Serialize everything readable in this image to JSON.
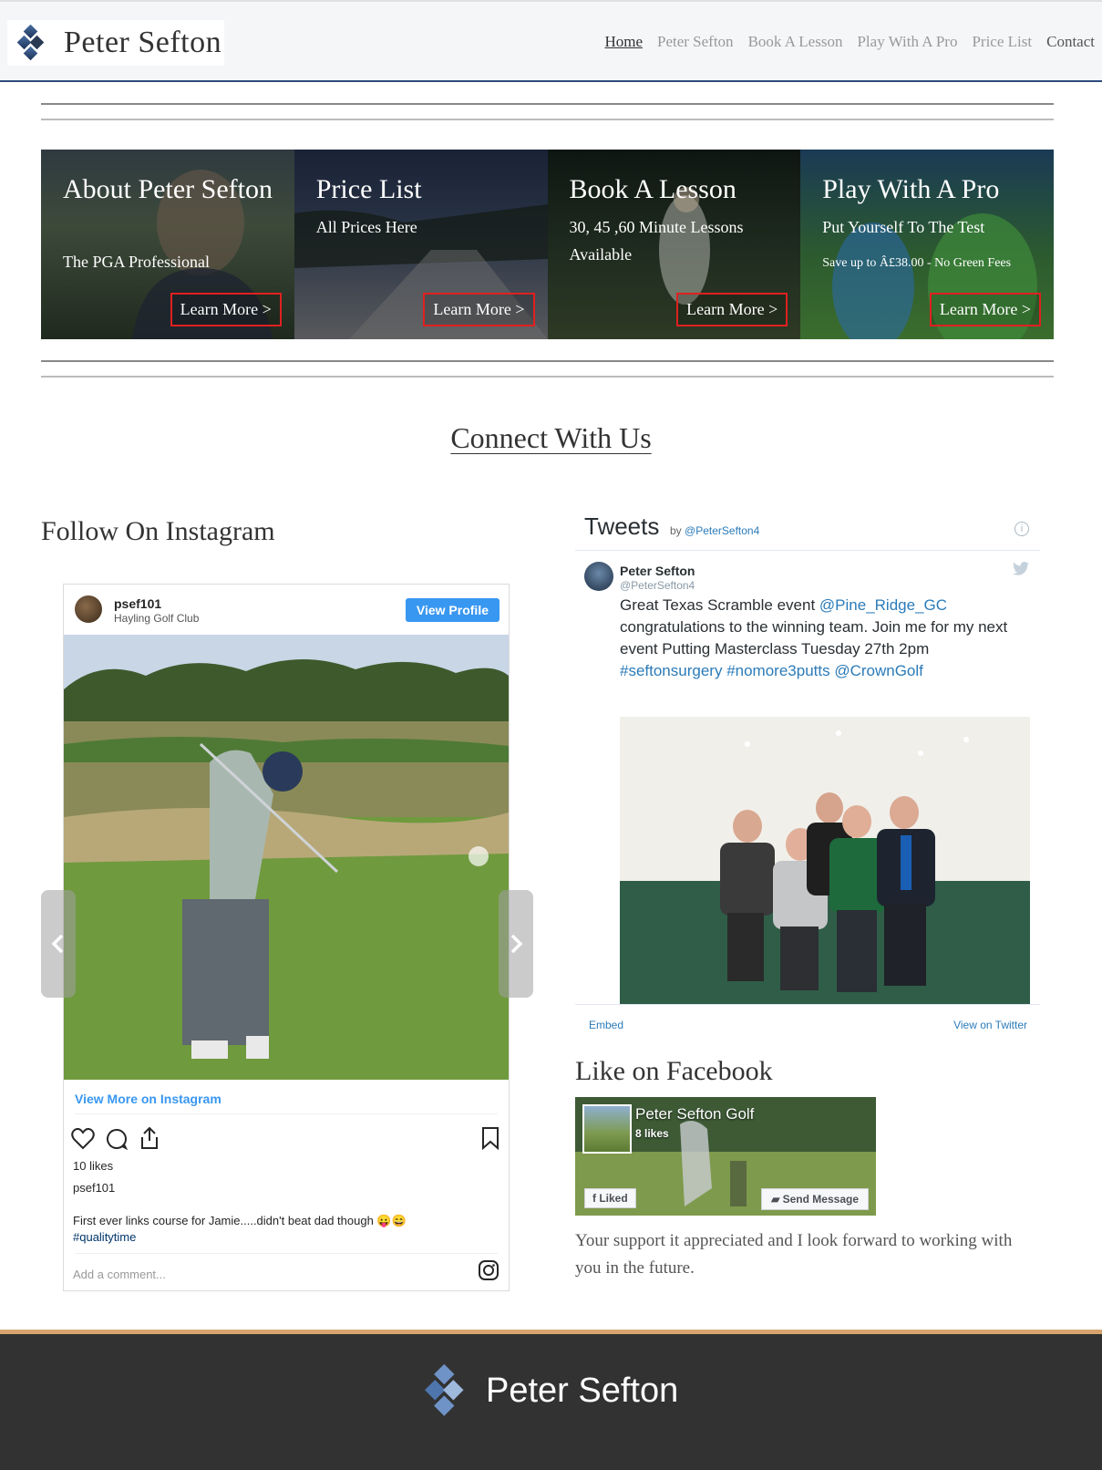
{
  "header": {
    "logo_text": "Peter Sefton",
    "nav": [
      {
        "label": "Home",
        "active": true
      },
      {
        "label": "Peter Sefton"
      },
      {
        "label": "Book A Lesson"
      },
      {
        "label": "Play With A Pro"
      },
      {
        "label": "Price List"
      },
      {
        "label": "Contact"
      }
    ]
  },
  "tiles": [
    {
      "title": "About Peter Sefton",
      "subtitle": "The PGA Professional",
      "button": "Learn More >"
    },
    {
      "title": "Price List",
      "subtitle": "All Prices Here",
      "button": "Learn More >"
    },
    {
      "title": "Book A Lesson",
      "subtitle": "30, 45 ,60 Minute Lessons Available",
      "button": "Learn More >"
    },
    {
      "title": "Play With A Pro",
      "subtitle": "Put Yourself To The Test",
      "subtitle2": "Save up to Â£38.00 - No Green Fees",
      "button": "Learn More >"
    }
  ],
  "connect": {
    "heading": "Connect With Us"
  },
  "instagram": {
    "heading": "Follow On Instagram",
    "username": "psef101",
    "location": "Hayling Golf Club",
    "view_profile": "View Profile",
    "view_more": "View More on Instagram",
    "likes": "10 likes",
    "owner": "psef101",
    "caption": "First ever links course for Jamie.....didn't beat dad though 😛😄",
    "hashtag": "#qualitytime",
    "comment_placeholder": "Add a comment..."
  },
  "twitter": {
    "title": "Tweets",
    "by": "by",
    "handle_link": "@PeterSefton4",
    "author_name": "Peter Sefton",
    "author_handle": "@PeterSefton4",
    "tweet_part1": "Great Texas Scramble event ",
    "tweet_mention1": "@Pine_Ridge_GC",
    "tweet_part2": " congratulations to the winning team. Join me for my next event Putting Masterclass Tuesday 27th 2pm ",
    "tweet_tag1": "#seftonsurgery",
    "tweet_tag2": "#nomore3putts",
    "tweet_mention2": "@CrownGolf",
    "embed": "Embed",
    "view_on": "View on Twitter"
  },
  "facebook": {
    "heading": "Like on Facebook",
    "page_name": "Peter Sefton Golf",
    "likes": "8 likes",
    "liked_button": "Liked",
    "message_button": "Send Message",
    "support_text": "Your support it appreciated and I look forward to working with you in the future."
  },
  "footer": {
    "logo_text": "Peter Sefton"
  },
  "colors": {
    "nav_border": "#2d4c7e",
    "button_border": "#e02020",
    "footer_bg": "#323232",
    "footer_accent": "#d9a46e",
    "instagram_blue": "#3897f0",
    "twitter_link": "#2b7bb9"
  }
}
